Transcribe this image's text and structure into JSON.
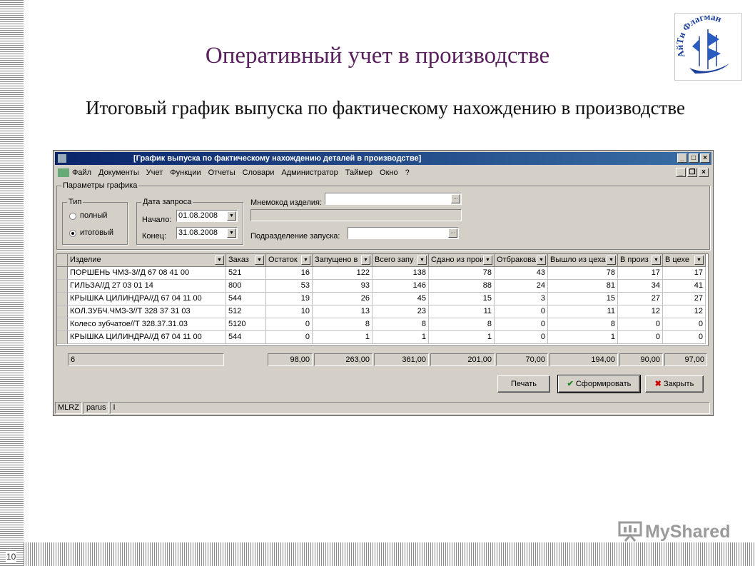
{
  "slide": {
    "title": "Оперативный учет в производстве",
    "subtitle": "Итоговый график выпуска по фактическому нахождению в производстве",
    "number": "10",
    "logo_text": "АйТи Флагман",
    "watermark": "MyShared"
  },
  "window": {
    "title": "[График выпуска  по фактическому нахождению деталей в производстве]",
    "menu": [
      "Файл",
      "Документы",
      "Учет",
      "Функции",
      "Отчеты",
      "Словари",
      "Администратор",
      "Таймер",
      "Окно",
      "?"
    ]
  },
  "params": {
    "group_title": "Параметры графика",
    "type_title": "Тип",
    "type_options": [
      "полный",
      "итоговый"
    ],
    "type_selected": "итоговый",
    "date_title": "Дата запроса",
    "start_label": "Начало:",
    "start_value": "01.08.2008",
    "end_label": "Конец:",
    "end_value": "31.08.2008",
    "mnemo_label": "Мнемокод изделия:",
    "mnemo_value": "",
    "dept_label": "Подразделение запуска:",
    "dept_value": ""
  },
  "table": {
    "columns": [
      "Изделие",
      "Заказ",
      "Остаток",
      "Запущено в",
      "Всего запу",
      "Сдано из прои",
      "Отбракова",
      "Вышло из цеха",
      "В произ",
      "В цехе"
    ],
    "rows": [
      [
        "ПОРШЕНЬ ЧМЗ-3//Д 67 08 41 00",
        "521",
        "16",
        "122",
        "138",
        "78",
        "43",
        "78",
        "17",
        "17"
      ],
      [
        "ГИЛЬЗА//Д 27 03 01 14",
        "800",
        "53",
        "93",
        "146",
        "88",
        "24",
        "81",
        "34",
        "41"
      ],
      [
        "КРЫШКА ЦИЛИНДРА//Д 67 04 11 00",
        "544",
        "19",
        "26",
        "45",
        "15",
        "3",
        "15",
        "27",
        "27"
      ],
      [
        "КОЛ.ЗУБЧ.ЧМЗ-3//Т 328 37 31 03",
        "512",
        "10",
        "13",
        "23",
        "11",
        "0",
        "11",
        "12",
        "12"
      ],
      [
        "Колесо зубчатое//Т 328.37.31.03",
        "5120",
        "0",
        "8",
        "8",
        "8",
        "0",
        "8",
        "0",
        "0"
      ],
      [
        "КРЫШКА ЦИЛИНДРА//Д 67 04 11 00",
        "544",
        "0",
        "1",
        "1",
        "1",
        "0",
        "1",
        "0",
        "0"
      ]
    ],
    "totals": {
      "count": "6",
      "values": [
        "98,00",
        "263,00",
        "361,00",
        "201,00",
        "70,00",
        "194,00",
        "90,00",
        "97,00"
      ]
    }
  },
  "buttons": {
    "print": "Печать",
    "generate": "Сформировать",
    "close": "Закрыть"
  },
  "status": [
    "MLRZ",
    "parus",
    "I"
  ],
  "colors": {
    "title": "#5a1f5f",
    "titlebar": "#0a246a",
    "face": "#d4d0c8"
  }
}
